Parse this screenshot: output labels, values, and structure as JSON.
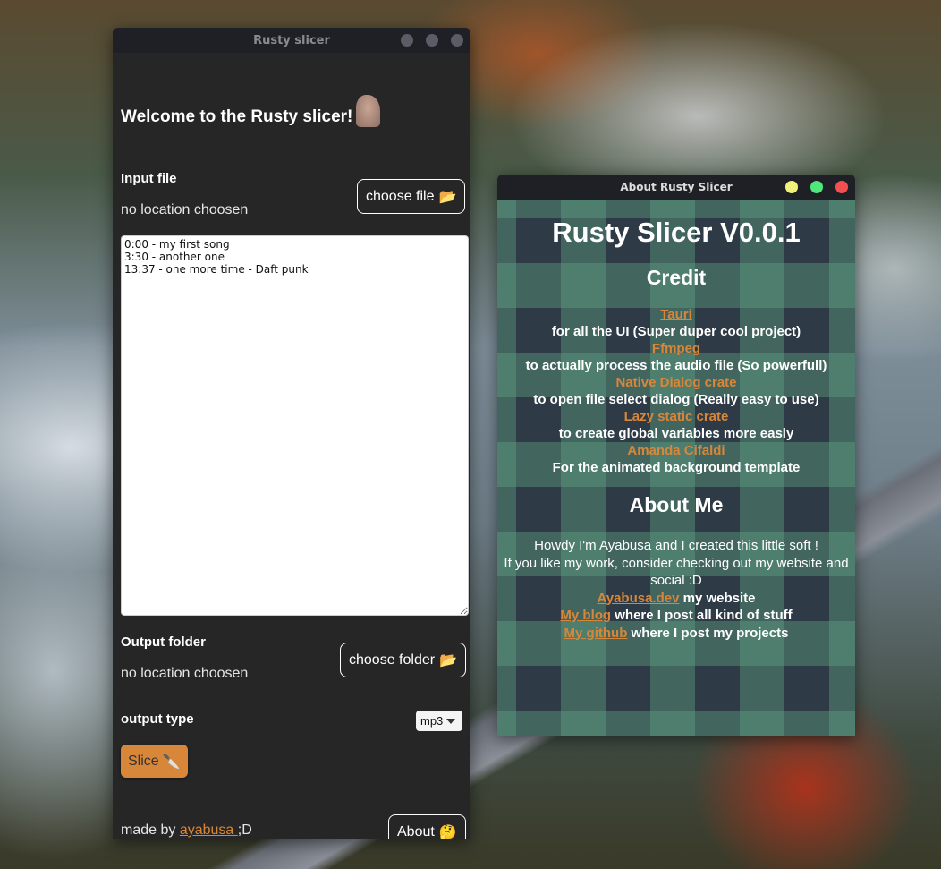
{
  "main_window": {
    "title": "Rusty slicer",
    "welcome": "Welcome to the Rusty slicer!",
    "input_label": "Input file",
    "input_location": "no location choosen",
    "choose_file": "choose file",
    "folder_emoji": "📂",
    "timestamps": "0:00 - my first song\n3:30 - another one\n13:37 - one more time - Daft punk",
    "output_label": "Output folder",
    "output_location": "no location choosen",
    "choose_folder": "choose folder",
    "output_type_label": "output type",
    "output_type_value": "mp3",
    "slice_label": "Slice",
    "slice_emoji": "🔪",
    "made_by": "made by",
    "author_link": "ayabusa ",
    "made_by_suffix": ";D",
    "about_label": "About",
    "about_emoji": "🤔"
  },
  "about_window": {
    "title": "About Rusty Slicer",
    "heading": "Rusty Slicer V0.0.1",
    "credit_heading": "Credit",
    "credits": [
      {
        "link": "Tauri",
        "desc": "for all the UI (Super duper cool project)"
      },
      {
        "link": "Ffmpeg",
        "desc": "to actually process the audio file (So powerfull)"
      },
      {
        "link": "Native Dialog crate",
        "desc": "to open file select dialog (Really easy to use)"
      },
      {
        "link": "Lazy static crate",
        "desc": "to create global variables more easly"
      },
      {
        "link": "Amanda Cifaldi",
        "desc": "For the animated background template"
      }
    ],
    "about_heading": "About Me",
    "intro_1": "Howdy I'm Ayabusa and I created this little soft !",
    "intro_2": "If you like my work, consider checking out my website and social :D",
    "links": [
      {
        "link": "Ayabusa.dev",
        "desc": " my website"
      },
      {
        "link": "My blog",
        "desc": " where I post all kind of stuff"
      },
      {
        "link": "My github",
        "desc": " where I post my projects"
      }
    ]
  },
  "colors": {
    "accent": "#d8873a",
    "window_bg": "#262626",
    "titlebar": "#1f1f26"
  }
}
